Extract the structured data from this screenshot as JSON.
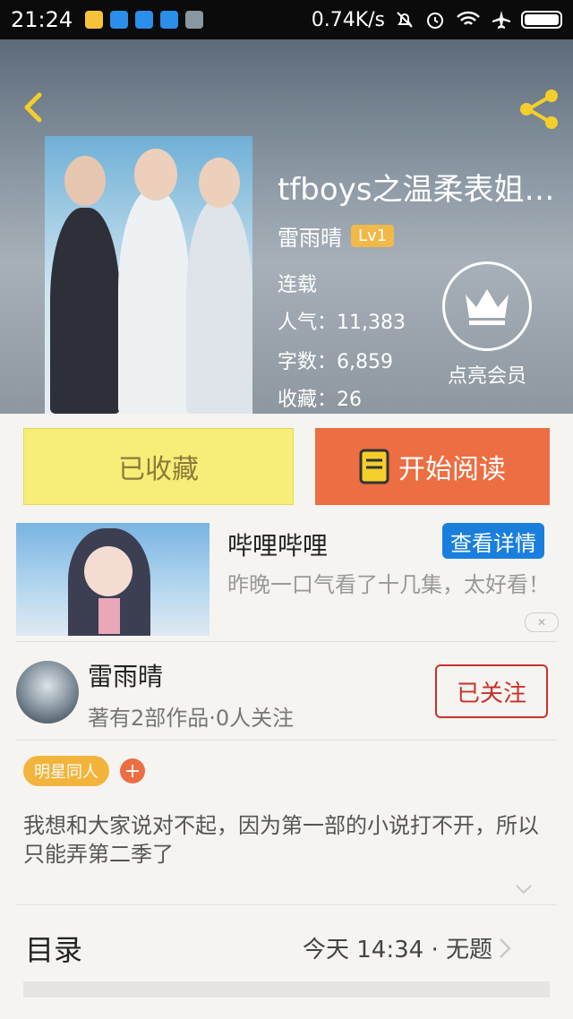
{
  "status_bar": {
    "time": "21:24",
    "network_speed": "0.74K/s",
    "icons": [
      "mute-icon",
      "alarm-icon",
      "wifi-icon",
      "airplane-icon",
      "battery-icon"
    ]
  },
  "header": {
    "book_title": "tfboys之温柔表姐…",
    "author": "雷雨晴",
    "level": "Lv1",
    "status": "连载",
    "popularity": "人气：11,383",
    "word_count": "字数：6,859",
    "favorites": "收藏：26",
    "vip_label": "点亮会员"
  },
  "actions": {
    "collected_label": "已收藏",
    "read_label": "开始阅读"
  },
  "ad": {
    "title": "哔哩哔哩",
    "button": "查看详情",
    "description": "昨晚一口气看了十几集，太好看！",
    "close": "✕"
  },
  "author_card": {
    "name": "雷雨晴",
    "meta": "著有2部作品·0人关注",
    "follow_label": "已关注"
  },
  "tags": {
    "items": [
      "明星同人"
    ],
    "add": "+"
  },
  "description": "我想和大家说对不起，因为第一部的小说打不开，所以只能弄第二季了",
  "toc": {
    "label": "目录",
    "latest": "今天 14:34 · 无题"
  },
  "colors": {
    "accent_orange": "#ec6e42",
    "collect_yellow": "#f7ee77",
    "follow_red": "#c9312a",
    "ad_blue": "#1a7fdc",
    "tag_orange": "#f3b43c"
  }
}
